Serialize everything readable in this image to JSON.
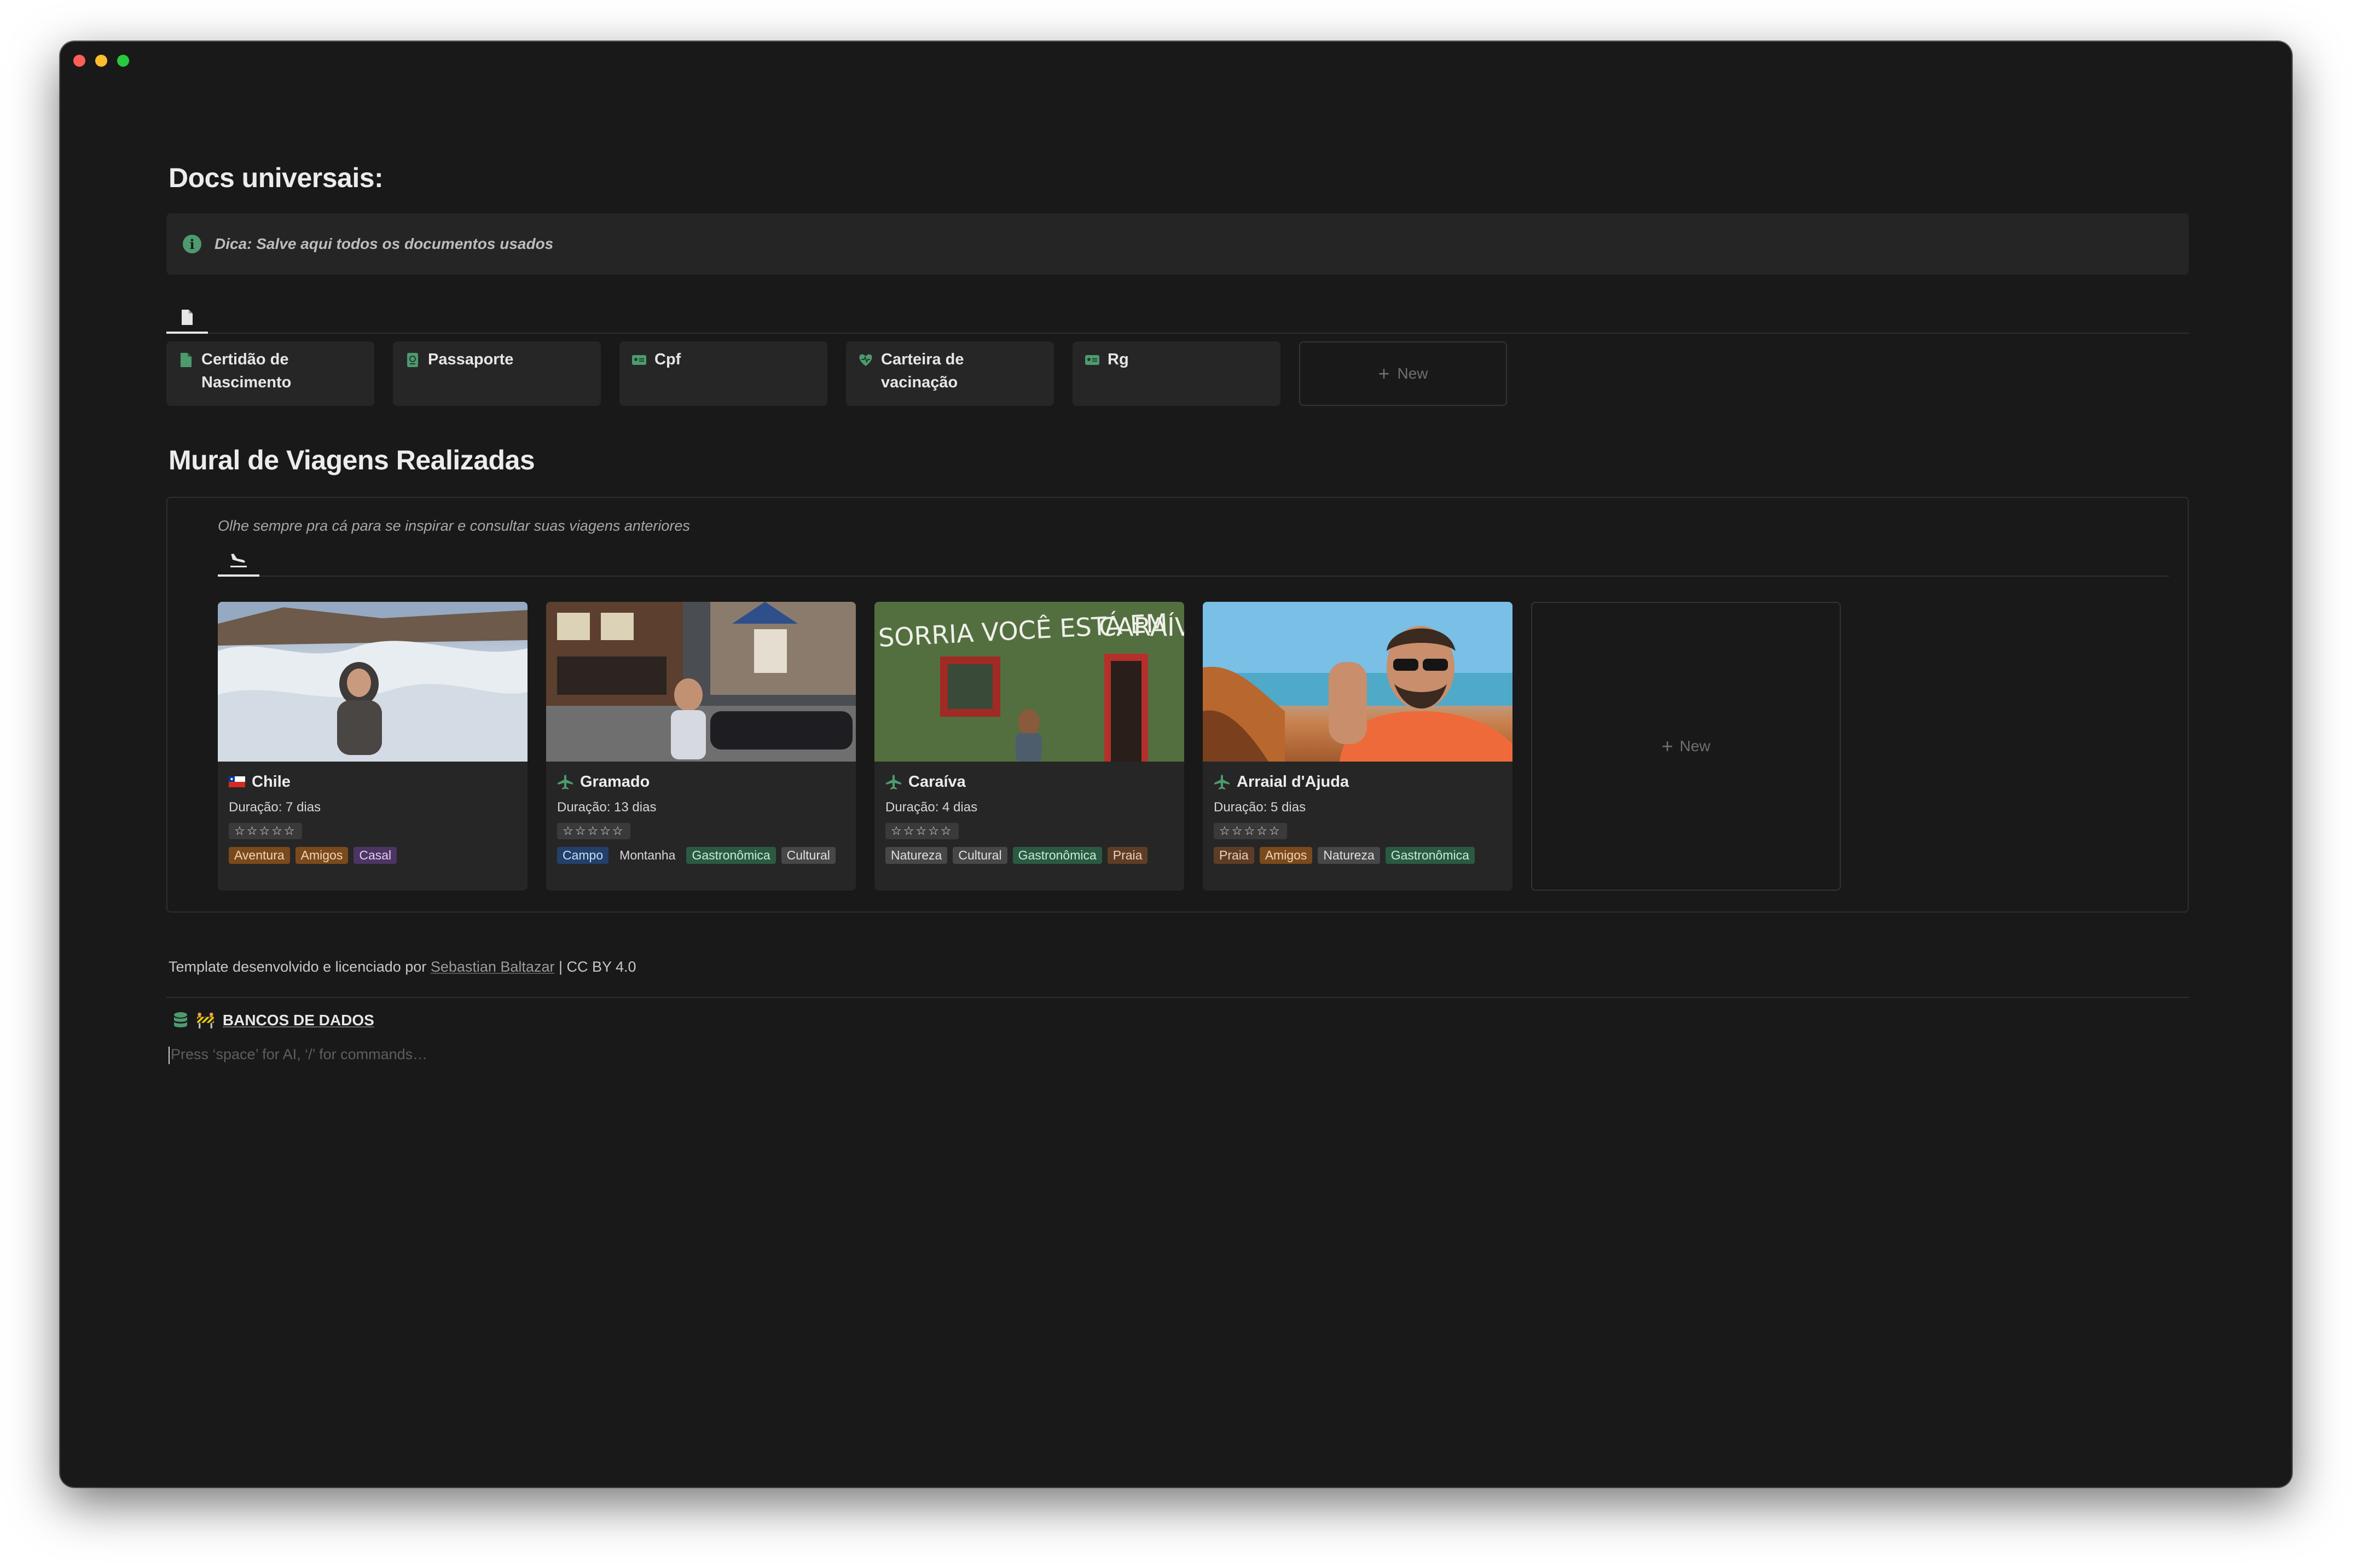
{
  "docs_section": {
    "title": "Docs universais:",
    "callout": "Dica: Salve aqui todos os documentos usados",
    "cards": [
      {
        "label": "Certidão de Nascimento",
        "icon": "document-icon"
      },
      {
        "label": "Passaporte",
        "icon": "passport-icon"
      },
      {
        "label": "Cpf",
        "icon": "id-card-icon"
      },
      {
        "label": "Carteira de vacinação",
        "icon": "heart-icon"
      },
      {
        "label": "Rg",
        "icon": "id-card-icon"
      }
    ],
    "new_label": "New"
  },
  "mural_section": {
    "title": "Mural de Viagens Realizadas",
    "description": "Olhe sempre pra cá para se inspirar e consultar suas viagens anteriores",
    "trips": [
      {
        "name": "Chile",
        "icon": "chile-flag-icon",
        "duration": "Duração: 7 dias",
        "rating": "☆☆☆☆☆",
        "tags": [
          {
            "label": "Aventura",
            "color": "orange"
          },
          {
            "label": "Amigos",
            "color": "orange"
          },
          {
            "label": "Casal",
            "color": "purple"
          }
        ]
      },
      {
        "name": "Gramado",
        "icon": "airplane-icon",
        "duration": "Duração: 13 dias",
        "rating": "☆☆☆☆☆",
        "tags": [
          {
            "label": "Campo",
            "color": "blue"
          },
          {
            "label": "Montanha",
            "color": "plain"
          },
          {
            "label": "Gastronômica",
            "color": "green"
          },
          {
            "label": "Cultural",
            "color": "gray"
          }
        ]
      },
      {
        "name": "Caraíva",
        "icon": "airplane-icon",
        "duration": "Duração: 4 dias",
        "rating": "☆☆☆☆☆",
        "tags": [
          {
            "label": "Natureza",
            "color": "gray"
          },
          {
            "label": "Cultural",
            "color": "gray"
          },
          {
            "label": "Gastronômica",
            "color": "green"
          },
          {
            "label": "Praia",
            "color": "brown"
          }
        ]
      },
      {
        "name": "Arraial d'Ajuda",
        "icon": "airplane-icon",
        "duration": "Duração: 5 dias",
        "rating": "☆☆☆☆☆",
        "tags": [
          {
            "label": "Praia",
            "color": "brown"
          },
          {
            "label": "Amigos",
            "color": "orange"
          },
          {
            "label": "Natureza",
            "color": "gray"
          },
          {
            "label": "Gastronômica",
            "color": "green"
          }
        ]
      }
    ],
    "new_label": "New"
  },
  "footer": {
    "text": "Template desenvolvido e licenciado por",
    "author": "Sebastian Baltazar",
    "license": "| CC BY 4.0"
  },
  "databases_link": {
    "label": "BANCOS DE DADOS",
    "emoji": "🚧"
  },
  "editor_placeholder": "Press ‘space’ for AI, ‘/’ for commands…",
  "colors": {
    "background": "#191919",
    "card": "#262626",
    "accent_green": "#4e9a6f"
  }
}
